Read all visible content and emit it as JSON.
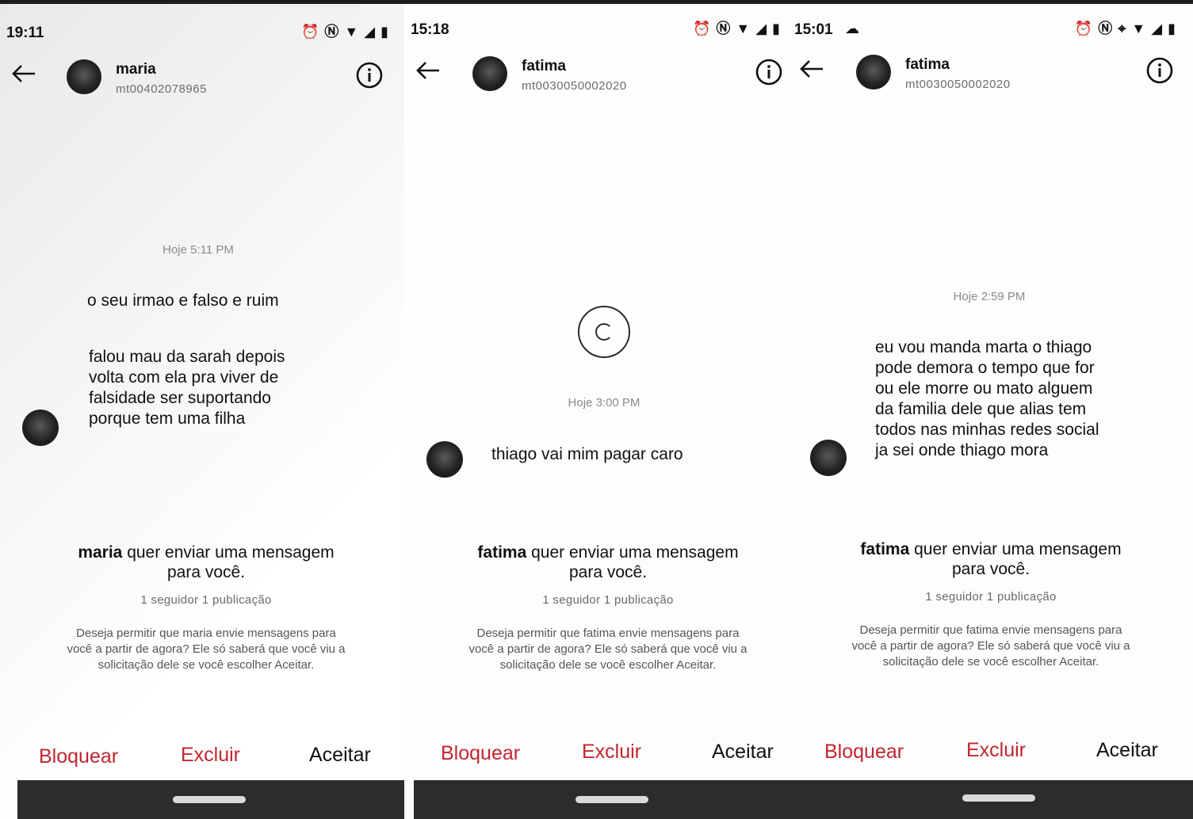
{
  "screens": [
    {
      "status_time": "19:11",
      "contact_name": "maria",
      "contact_username": "mt00402078965",
      "date_label": "Hoje 5:11 PM",
      "messages": [
        "o seu irmao e falso e ruim",
        "falou mau da sarah depois\nvolta com ela pra viver de\nfalsidade ser suportando\nporque tem uma filha"
      ],
      "request_name": "maria",
      "request_text": " quer enviar uma mensagem\npara você.",
      "request_stats": "1 seguidor 1 publicação",
      "request_desc": "Deseja permitir que maria envie mensagens para\nvocê a partir de agora? Ele só saberá que você viu a\nsolicitação dele se você escolher Aceitar.",
      "actions": {
        "block": "Bloquear",
        "delete": "Excluir",
        "accept": "Aceitar"
      }
    },
    {
      "status_time": "15:18",
      "contact_name": "fatima",
      "contact_username": "mt0030050002020",
      "date_label": "Hoje 3:00 PM",
      "messages": [
        "thiago vai mim pagar caro"
      ],
      "request_name": "fatima",
      "request_text": " quer enviar uma mensagem\npara você.",
      "request_stats": "1 seguidor 1 publicação",
      "request_desc": "Deseja permitir que fatima envie mensagens para\nvocê a partir de agora? Ele só saberá que você viu a\nsolicitação dele se você escolher Aceitar.",
      "actions": {
        "block": "Bloquear",
        "delete": "Excluir",
        "accept": "Aceitar"
      }
    },
    {
      "status_time": "15:01",
      "contact_name": "fatima",
      "contact_username": "mt0030050002020",
      "date_label": "Hoje 2:59 PM",
      "messages": [
        "eu  vou manda marta o thiago\npode demora o tempo que for\nou ele morre ou mato alguem\nda familia dele que alias tem\ntodos  nas minhas redes social\nja sei onde thiago mora"
      ],
      "request_name": "fatima",
      "request_text": " quer enviar uma mensagem\npara você.",
      "request_stats": "1 seguidor 1 publicação",
      "request_desc": "Deseja permitir que fatima envie mensagens para\nvocê a partir de agora? Ele só saberá que você viu a\nsolicitação dele se você escolher Aceitar.",
      "actions": {
        "block": "Bloquear",
        "delete": "Excluir",
        "accept": "Aceitar"
      }
    }
  ],
  "icons": [
    "alarm-icon",
    "nfc-icon",
    "wifi-icon",
    "signal-icon",
    "battery-icon",
    "location-icon",
    "back-arrow-icon",
    "info-icon",
    "loading-spinner-icon"
  ],
  "colors": {
    "action_red": "#c1262f",
    "navbar": "#2a2c2e",
    "text": "#111111"
  }
}
